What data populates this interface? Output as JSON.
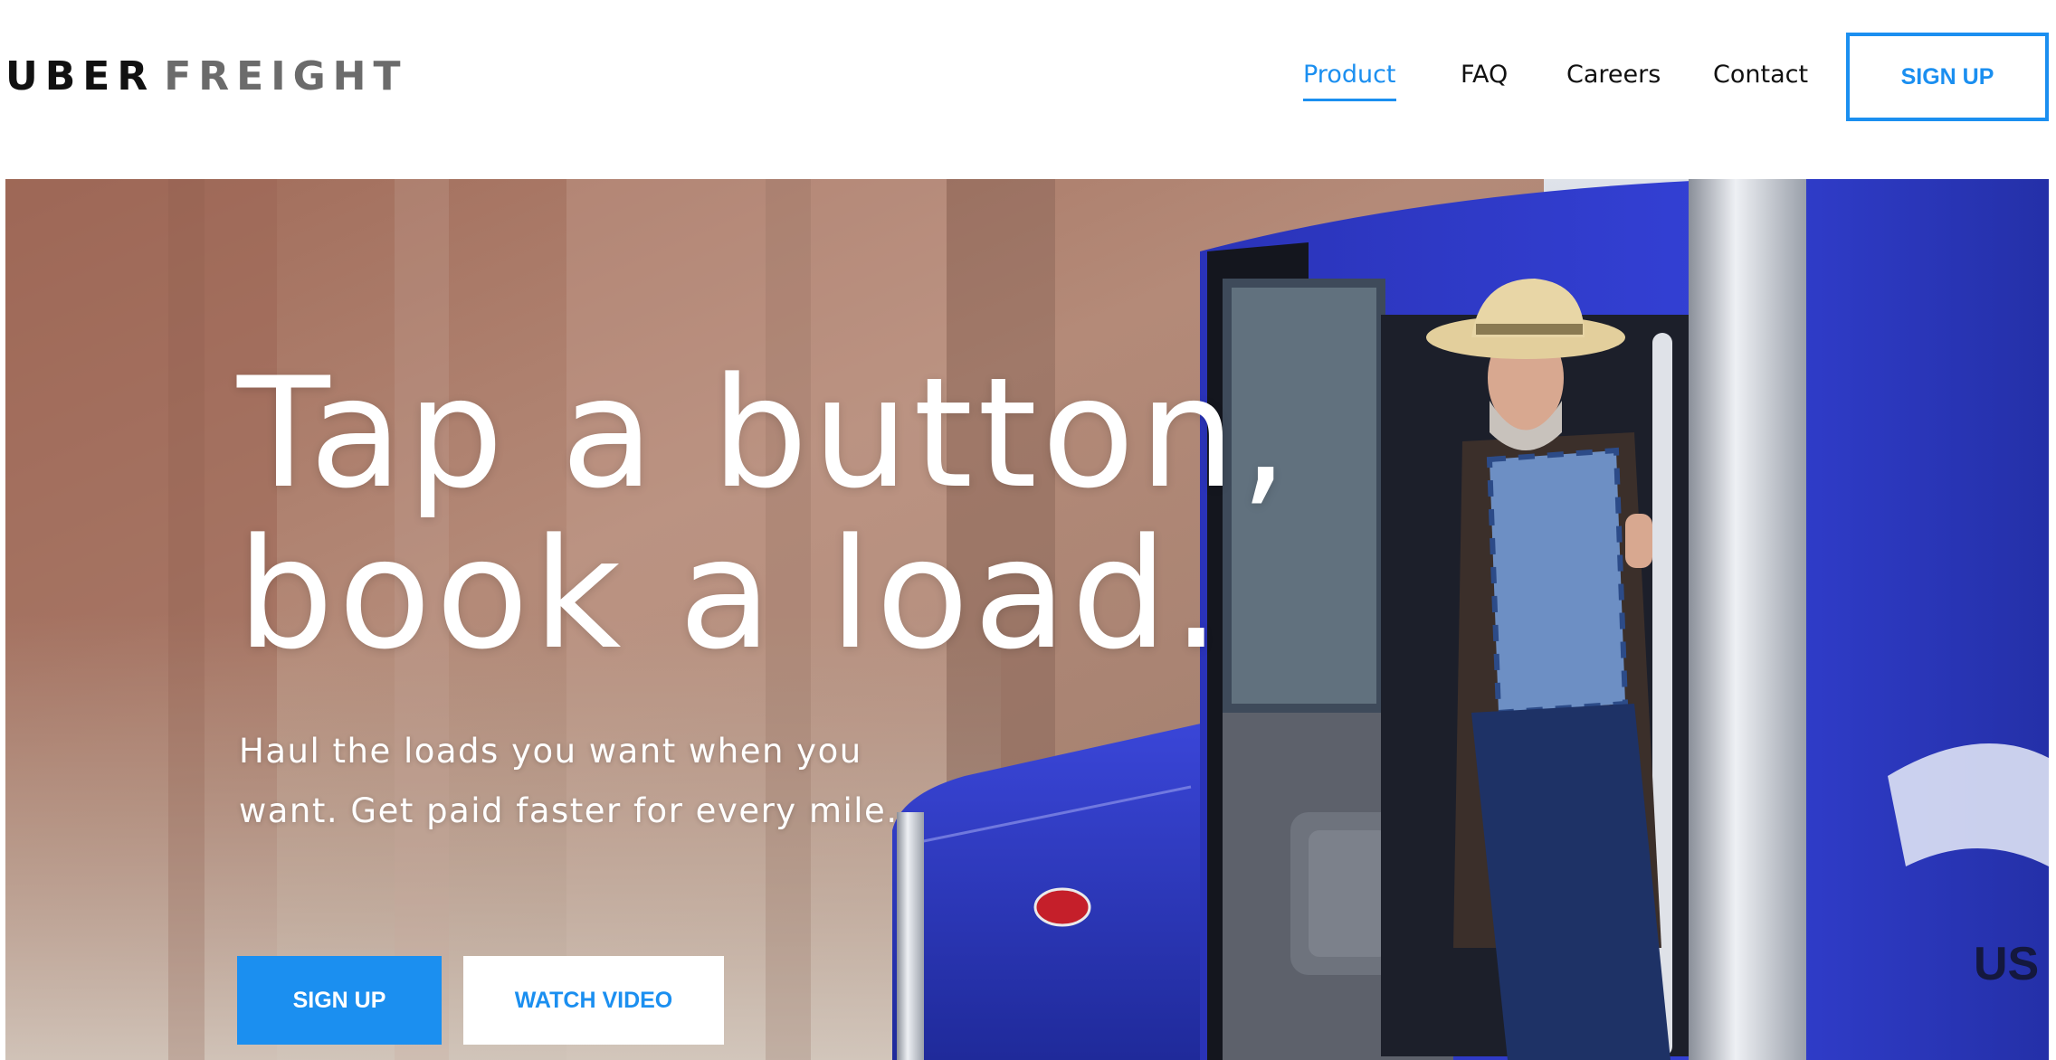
{
  "header": {
    "logo_word1": "UBER",
    "logo_word2": "FREIGHT",
    "nav": [
      {
        "label": "Product",
        "active": true
      },
      {
        "label": "FAQ",
        "active": false
      },
      {
        "label": "Careers",
        "active": false
      },
      {
        "label": "Contact",
        "active": false
      }
    ],
    "signup_label": "SIGN UP"
  },
  "hero": {
    "headline_line1": "Tap a button,",
    "headline_line2": "book a load.",
    "subtext": "Haul the loads you want when you want. Get paid faster for every mile.",
    "signup_label": "SIGN UP",
    "watch_video_label": "WATCH VIDEO",
    "truck_text": "US"
  },
  "colors": {
    "accent": "#1b8ff0",
    "text_dark": "#111111",
    "logo_grey": "#6b6b6b",
    "truck_blue": "#2b35c8"
  }
}
